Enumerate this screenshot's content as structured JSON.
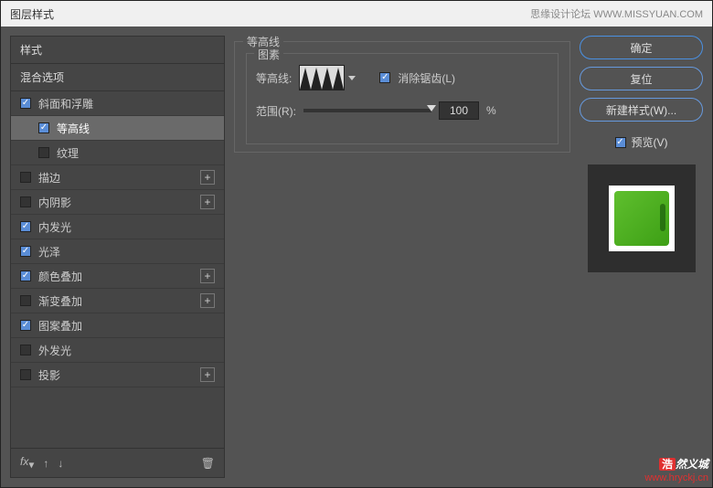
{
  "titlebar": {
    "title": "图层样式",
    "right": "思缘设计论坛  WWW.MISSYUAN.COM"
  },
  "sidebar": {
    "header": "样式",
    "mix": "混合选项",
    "items": [
      {
        "label": "斜面和浮雕",
        "checked": true,
        "plus": false,
        "indent": false
      },
      {
        "label": "等高线",
        "checked": true,
        "plus": false,
        "indent": true,
        "selected": true
      },
      {
        "label": "纹理",
        "checked": false,
        "plus": false,
        "indent": true
      },
      {
        "label": "描边",
        "checked": false,
        "plus": true,
        "indent": false
      },
      {
        "label": "内阴影",
        "checked": false,
        "plus": true,
        "indent": false
      },
      {
        "label": "内发光",
        "checked": true,
        "plus": false,
        "indent": false
      },
      {
        "label": "光泽",
        "checked": true,
        "plus": false,
        "indent": false
      },
      {
        "label": "颜色叠加",
        "checked": true,
        "plus": true,
        "indent": false
      },
      {
        "label": "渐变叠加",
        "checked": false,
        "plus": true,
        "indent": false
      },
      {
        "label": "图案叠加",
        "checked": true,
        "plus": false,
        "indent": false
      },
      {
        "label": "外发光",
        "checked": false,
        "plus": false,
        "indent": false
      },
      {
        "label": "投影",
        "checked": false,
        "plus": true,
        "indent": false
      }
    ],
    "footer_fx": "fx"
  },
  "center": {
    "title": "等高线",
    "fieldset": "图素",
    "contour_label": "等高线:",
    "antialias": "消除锯齿(L)",
    "range_label": "范围(R):",
    "range_value": "100",
    "range_pct": "%"
  },
  "right": {
    "ok": "确定",
    "reset": "复位",
    "newstyle": "新建样式(W)...",
    "preview": "预览(V)"
  },
  "watermark": {
    "line1a": "浩",
    "line1b": "然义城",
    "line2": "www.hryckj.cn"
  }
}
